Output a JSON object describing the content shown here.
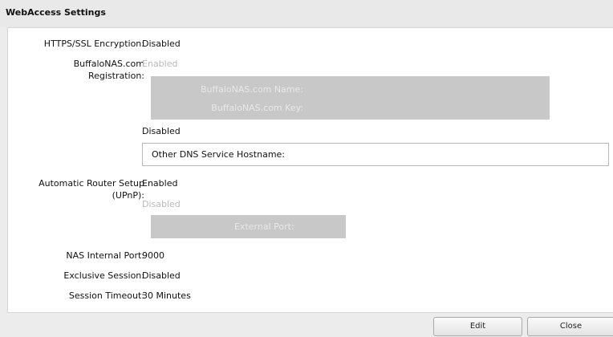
{
  "window": {
    "title": "WebAccess Settings"
  },
  "settings": {
    "https_label": "HTTPS/SSL Encryption:",
    "https_value": "Disabled",
    "buffalonas_label_line1": "BuffaloNAS.com",
    "buffalonas_label_line2": "Registration:",
    "buffalonas_value": "Enabled",
    "buffalonas_name_label": "BuffaloNAS.com Name:",
    "buffalonas_key_label": "BuffaloNAS.com Key:",
    "other_dns_value": "Disabled",
    "other_dns_hostname_label": "Other DNS Service Hostname:",
    "upnp_label_line1": "Automatic Router Setup",
    "upnp_label_line2": "(UPnP):",
    "upnp_value": "Enabled",
    "upnp_sub_value": "Disabled",
    "external_port_label": "External Port:",
    "nas_port_label": "NAS Internal Port:",
    "nas_port_value": "9000",
    "exclusive_label": "Exclusive Session:",
    "exclusive_value": "Disabled",
    "timeout_label": "Session Timeout:",
    "timeout_value": "30 Minutes"
  },
  "buttons": {
    "edit": "Edit",
    "close": "Close"
  }
}
